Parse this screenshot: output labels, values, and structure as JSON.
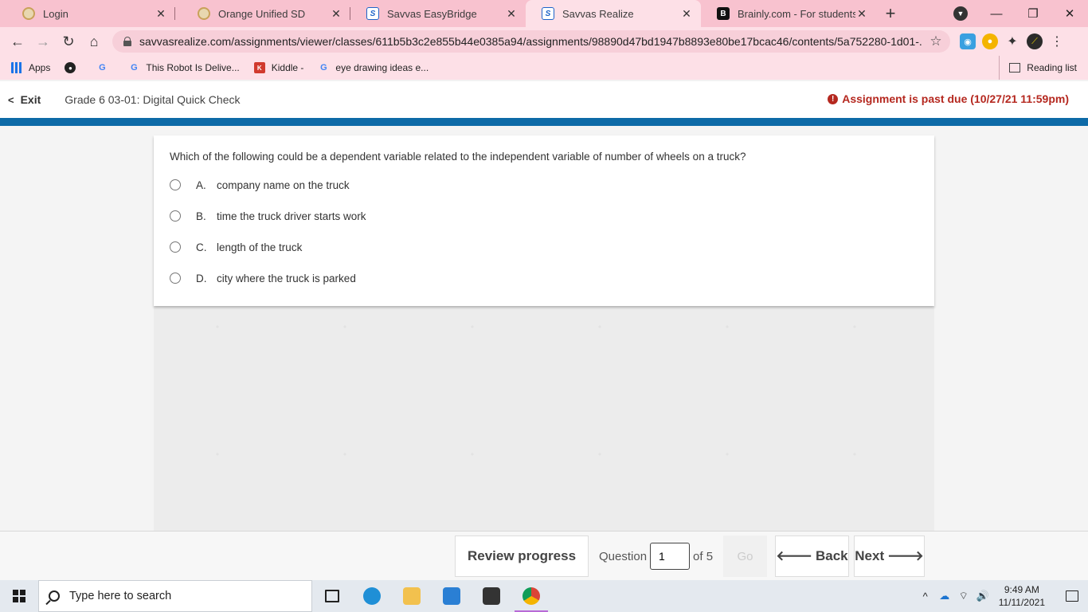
{
  "browser": {
    "tabs": [
      {
        "title": "Login",
        "icon": "clock-favicon-icon",
        "active": false
      },
      {
        "title": "Orange Unified SD",
        "icon": "clock-favicon-icon",
        "active": false
      },
      {
        "title": "Savvas EasyBridge",
        "icon": "savvas-favicon-icon",
        "active": false
      },
      {
        "title": "Savvas Realize",
        "icon": "savvas-favicon-icon",
        "active": true
      },
      {
        "title": "Brainly.com - For students. By",
        "icon": "brainly-favicon-icon",
        "active": false
      }
    ],
    "url": "savvasrealize.com/assignments/viewer/classes/611b5b3c2e855b44e0385a94/assignments/98890d47bd1947b8893e80be17bcac46/contents/5a752280-1d01-...",
    "bookmarks": [
      {
        "label": "Apps",
        "icon": "apps-grid-icon"
      },
      {
        "label": "",
        "icon": "globe-icon"
      },
      {
        "label": "",
        "icon": "google-icon"
      },
      {
        "label": "This Robot Is Delive...",
        "icon": "google-icon"
      },
      {
        "label": "Kiddle -",
        "icon": "kiddle-icon"
      },
      {
        "label": "eye drawing ideas e...",
        "icon": "google-icon"
      }
    ],
    "reading_list": "Reading list"
  },
  "header": {
    "exit_label": "Exit",
    "title": "Grade 6 03-01: Digital Quick Check",
    "past_due": "Assignment is past due (10/27/21 11:59pm)"
  },
  "question": {
    "text": "Which of the following could be a dependent variable related to the independent variable of number of wheels on a truck?",
    "choices": [
      {
        "letter": "A.",
        "text": "company name on the truck"
      },
      {
        "letter": "B.",
        "text": "time the truck driver starts work"
      },
      {
        "letter": "C.",
        "text": "length of the truck"
      },
      {
        "letter": "D.",
        "text": "city where the truck is parked"
      }
    ]
  },
  "footer": {
    "review_label": "Review progress",
    "question_label": "Question",
    "question_number": "1",
    "of_label": "of 5",
    "go_label": "Go",
    "back_label": "Back",
    "next_label": "Next"
  },
  "taskbar": {
    "search_placeholder": "Type here to search",
    "time": "9:49 AM",
    "date": "11/11/2021"
  },
  "colors": {
    "tab_strip": "#f8c2cf",
    "accent_blue": "#0d6aa7",
    "past_due_red": "#b5281f"
  }
}
